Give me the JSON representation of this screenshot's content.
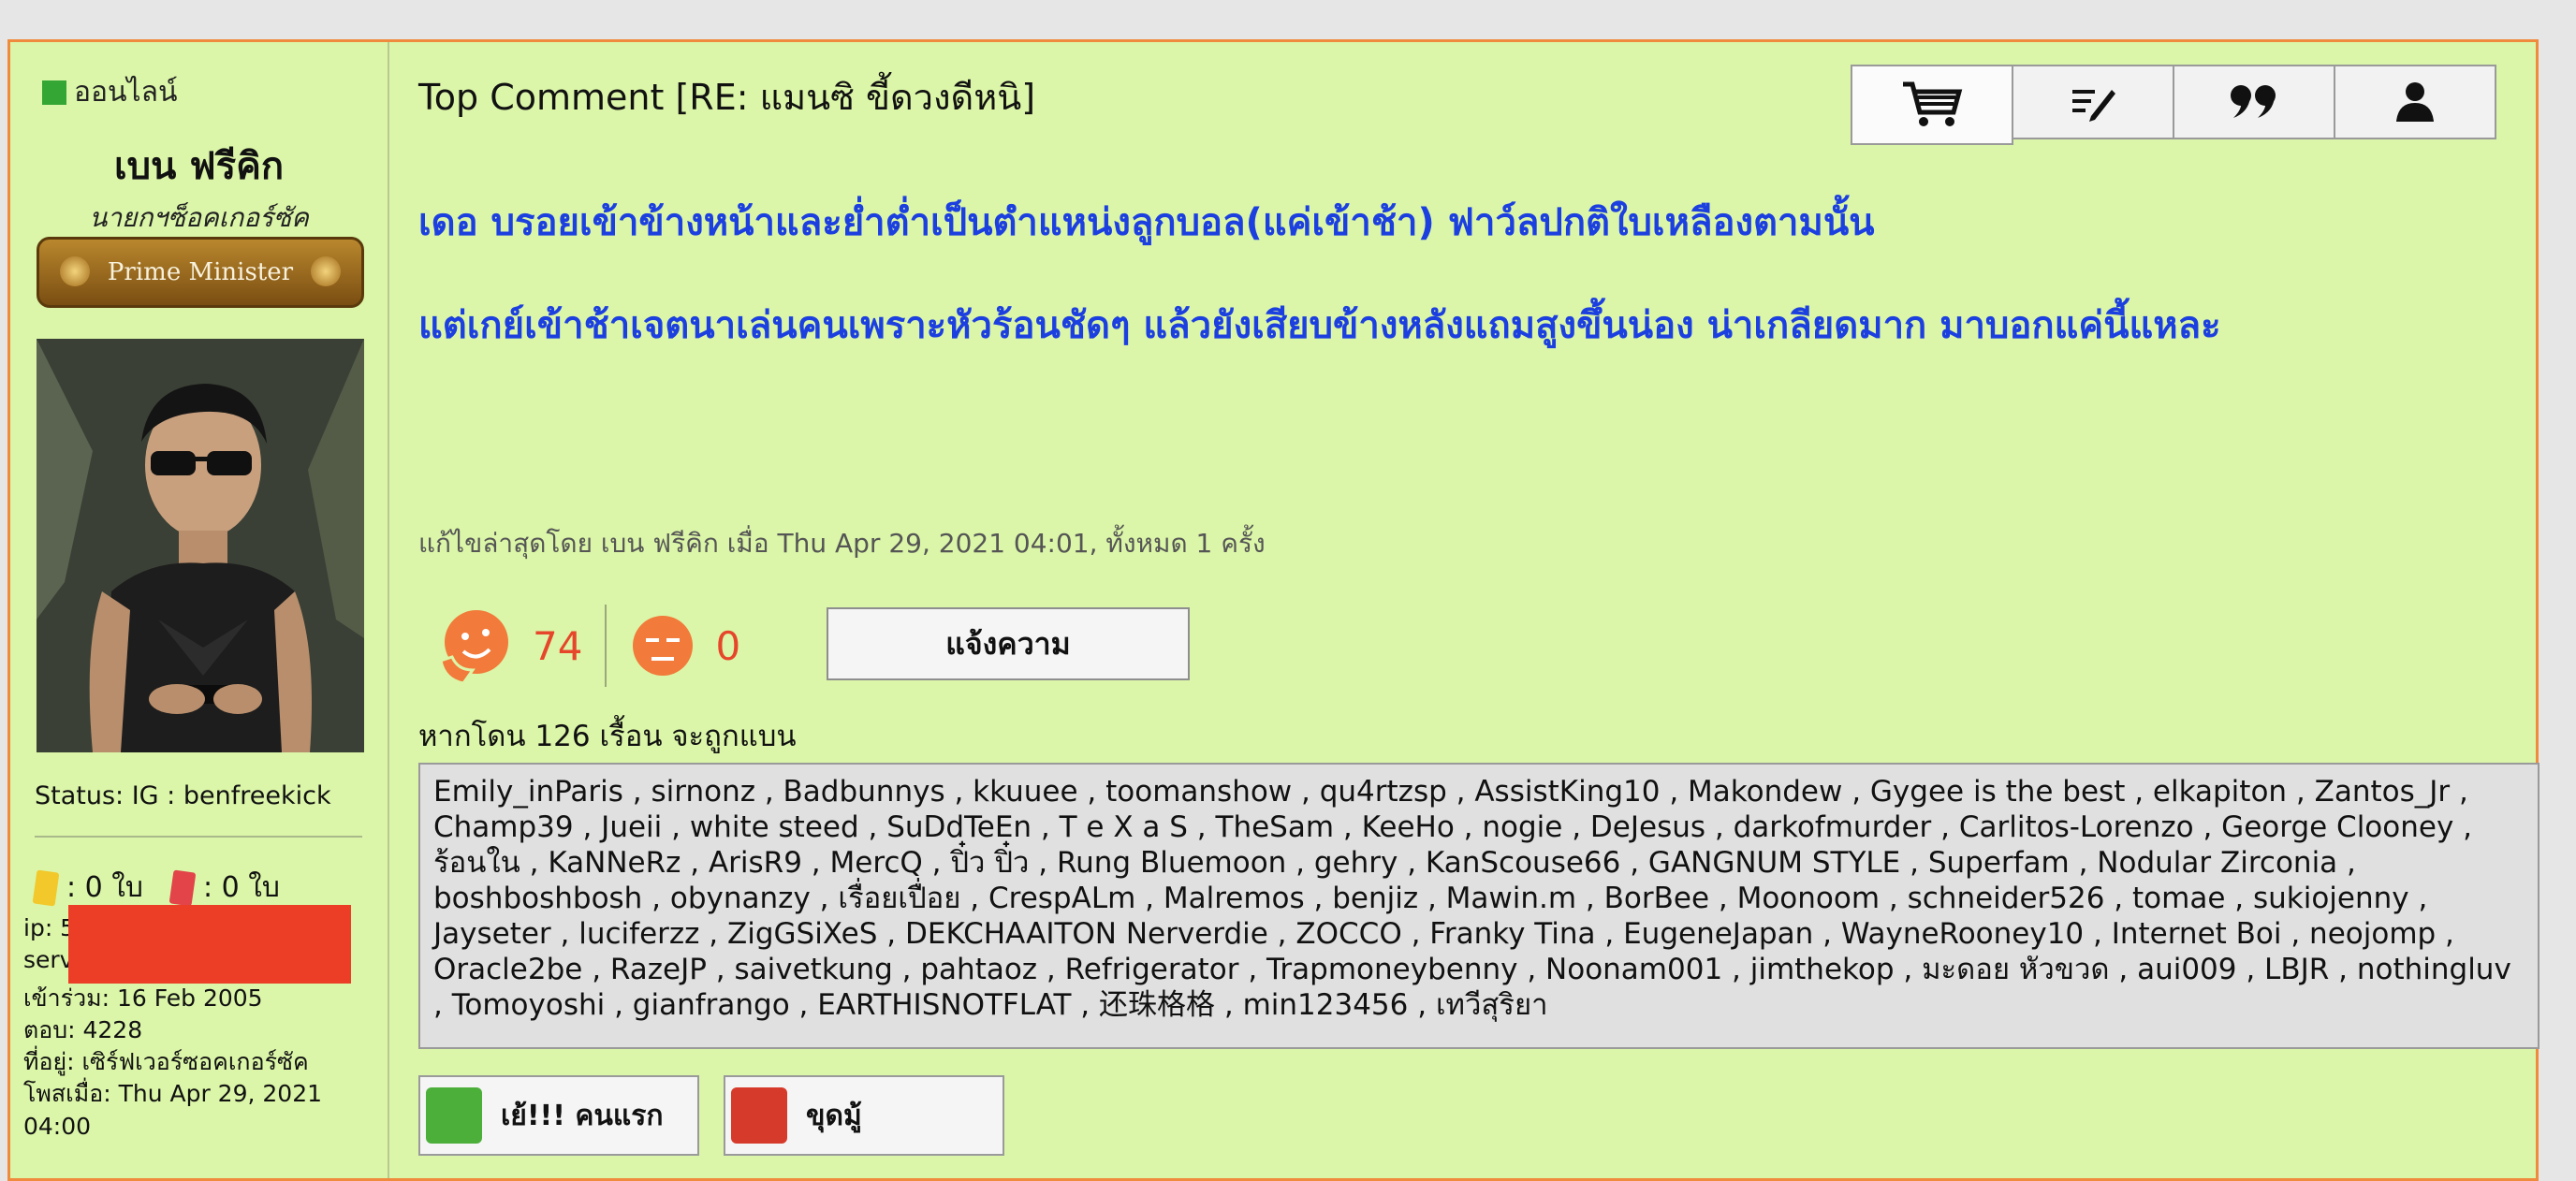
{
  "profile": {
    "online_label": "ออนไลน์",
    "username": "เบน ฟรีคิก",
    "title": "นายกฯซ็อคเกอร์ซัค",
    "rank_label": "Prime Minister",
    "status": "Status: IG : benfreekick",
    "yellow_cards": ": 0 ใบ",
    "red_cards": ": 0 ใบ",
    "ip_label": "ip: 5",
    "server_label": "serv",
    "joined": "เข้าร่วม: 16 Feb 2005",
    "replies": "ตอบ: 4228",
    "location": "ที่อยู่: เซิร์ฟเวอร์ซอคเกอร์ซัค",
    "posted": "โพสเมื่อ: Thu Apr 29, 2021 04:00"
  },
  "post": {
    "subject": "Top Comment [RE: แมนซิ ขี้ดวงดีหนิ]",
    "lines": [
      "เดอ บรอยเข้าข้างหน้าและย่ำต่ำเป็นตำแหน่งลูกบอล(แค่เข้าช้า) ฟาว์ลปกติใบเหลืองตามนั้น",
      "แต่เกย์เข้าช้าเจตนาเล่นคนเพราะหัวร้อนชัดๆ แล้วยังเสียบข้างหลังแถมสูงขึ้นน่อง น่าเกลียดมาก มาบอกแค่นี้แหละ"
    ],
    "edited_note": "แก้ไขล่าสุดโดย เบน ฟรีคิก เมื่อ Thu Apr 29, 2021 04:01, ทั้งหมด 1 ครั้ง",
    "likes": "74",
    "dislikes": "0",
    "report_label": "แจ้งความ",
    "ban_note": "หากโดน 126 เรื้อน จะถูกแบน",
    "kickers": "Emily_inParis , sirnonz , Badbunnys , kkuuee , toomanshow , qu4rtzsp , AssistKing10 , Makondew , Gygee is the best , elkapiton , Zantos_Jr , Champ39 , Jueii , white steed , SuDdTeEn , T e X a S , TheSam , KeeHo , nogie , DeJesus , darkofmurder , Carlitos-Lorenzo , George Clooney , ร้อนใน , KaNNeRz , ArisR9 , MercQ , ปิ๋ว ปิ๋ว , Rung Bluemoon , gehry , KanScouse66 , GANGNUM STYLE , Superfam , Nodular Zirconia , boshboshbosh , obynanzy , เรื่อยเปื่อย , CrespALm , Malremos , benjiz , Mawin.m , BorBee , Moonoom , schneider526 , tomae , sukiojenny , Jayseter , luciferzz , ZigGSiXeS , DEKCHAAITON Nerverdie , ZOCCO , Franky Tina , EugeneJapan , WayneRooney10 , Internet Boi , neojomp , Oracle2be , RazeJP , saivetkung , pahtaoz , Refrigerator , Trapmoneybenny , Noonam001 , jimthekop , มะดอย หัวขวด , aui009 , LBJR , nothingluv , Tomoyoshi , gianfrango , EARTHISNOTFLAT , 还珠格格 , min123456 , เทวีสุริยา",
    "badge_first": "เย้!!! คนแรก",
    "badge_dig": "ขุดมู้"
  },
  "icons": {
    "cart": "cart-icon",
    "edit": "edit-icon",
    "quote": "quote-icon",
    "user": "user-icon",
    "like": "like-face-icon",
    "dislike": "dislike-face-icon"
  },
  "colors": {
    "post_bg": "#dbf6a8",
    "border": "#f08a3c",
    "message": "#1c3fe0",
    "vote": "#e6462a"
  }
}
